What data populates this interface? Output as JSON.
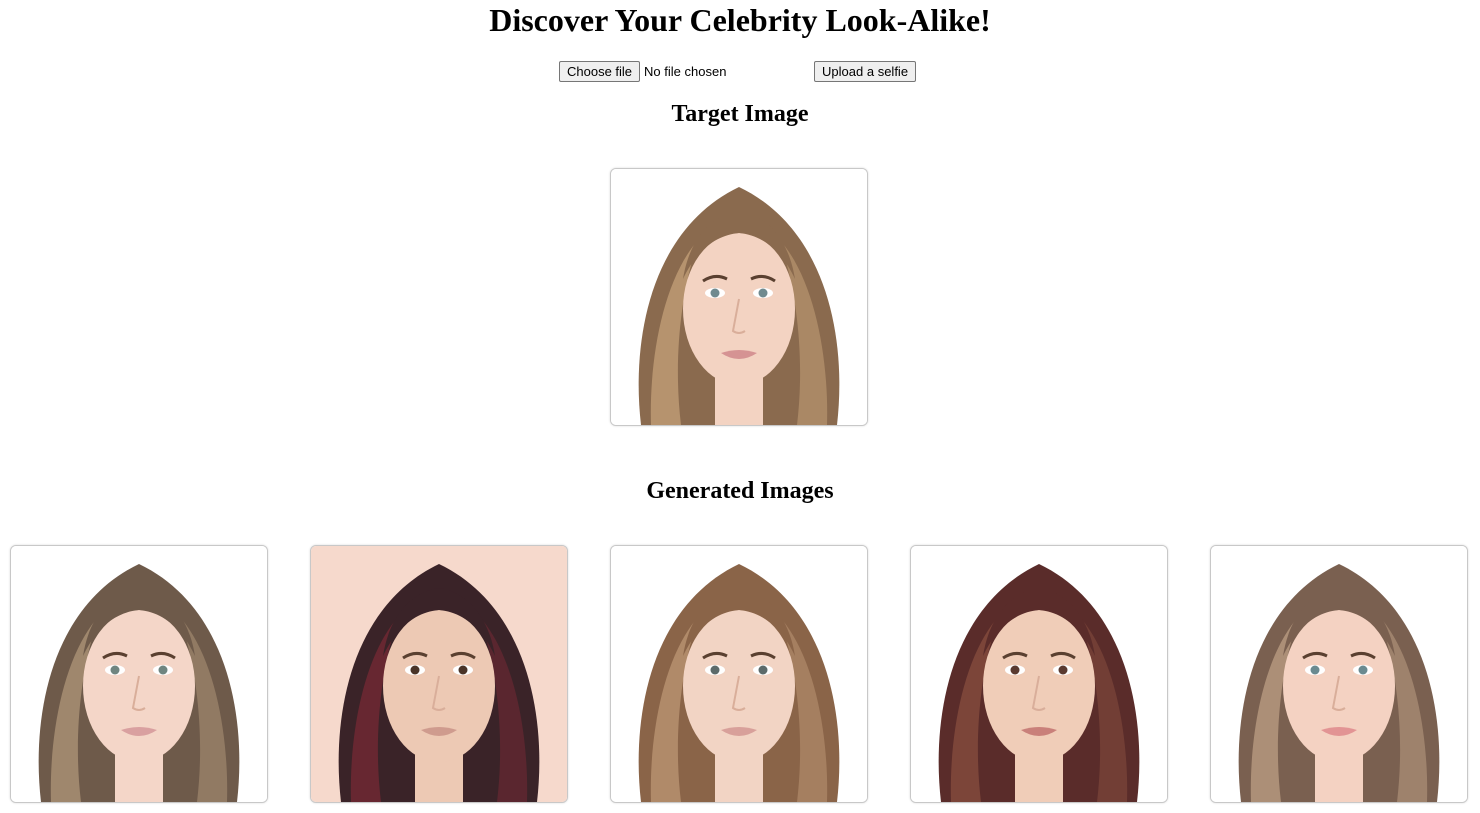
{
  "page": {
    "title": "Discover Your Celebrity Look-Alike!"
  },
  "upload": {
    "choose_label": "Choose file",
    "file_status": "No file chosen",
    "submit_label": "Upload a selfie"
  },
  "target": {
    "heading": "Target Image",
    "image": {
      "hair": "#8a6a4e",
      "hair_light": "#c9a57c",
      "skin": "#f3d3c2",
      "bg": "#ffffff",
      "eyes": "#6f8a8f",
      "lips": "#d59393"
    }
  },
  "generated": {
    "heading": "Generated Images",
    "images": [
      {
        "hair": "#6e5a4a",
        "hair_light": "#b49a7c",
        "skin": "#f4d6c8",
        "bg": "#ffffff",
        "eyes": "#6f8580",
        "lips": "#d9a0a0"
      },
      {
        "hair": "#3a2328",
        "hair_light": "#7a2a35",
        "skin": "#edc9b4",
        "bg": "#f6d9cc",
        "eyes": "#4a3428",
        "lips": "#cf9b8e"
      },
      {
        "hair": "#8a6448",
        "hair_light": "#c09a78",
        "skin": "#f2d4c4",
        "bg": "#ffffff",
        "eyes": "#5c6a6a",
        "lips": "#d8a09a"
      },
      {
        "hair": "#5a2c2a",
        "hair_light": "#8a5040",
        "skin": "#f0cdb8",
        "bg": "#ffffff",
        "eyes": "#5a3a30",
        "lips": "#c9807a"
      },
      {
        "hair": "#7a6050",
        "hair_light": "#c2a488",
        "skin": "#f4d2c2",
        "bg": "#ffffff",
        "eyes": "#6a8a90",
        "lips": "#e29494"
      }
    ]
  }
}
